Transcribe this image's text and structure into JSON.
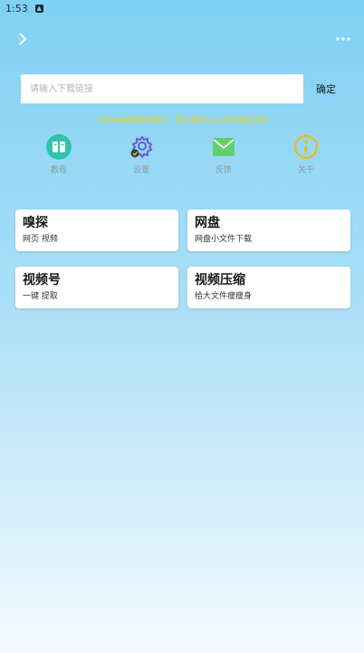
{
  "status_bar": {
    "time": "1:53",
    "notification_icon": "app-notification-icon"
  },
  "top_bar": {
    "back_icon": "chevron-right-icon",
    "more_icon": "more-dots-icon"
  },
  "search": {
    "placeholder": "请输入下载链接",
    "value": "",
    "confirm_label": "确定"
  },
  "notice": "全自动嗅探网络神器了，更多教程与QQ咨询请看文档",
  "quick_actions": [
    {
      "label": "教程",
      "icon": "book-icon",
      "color": "#2ec4a9"
    },
    {
      "label": "设置",
      "icon": "gear-icon",
      "color": "#6b5bd6"
    },
    {
      "label": "反馈",
      "icon": "mail-icon",
      "color": "#5fd06a"
    },
    {
      "label": "关于",
      "icon": "info-icon",
      "color": "#f2b51d"
    }
  ],
  "cards": [
    {
      "title": "嗅探",
      "subtitle": "网页 视频"
    },
    {
      "title": "网盘",
      "subtitle": "网盘小文件下载"
    },
    {
      "title": "视频号",
      "subtitle": "一键 提取"
    },
    {
      "title": "视频压缩",
      "subtitle": "给大文件瘦瘦身"
    }
  ]
}
